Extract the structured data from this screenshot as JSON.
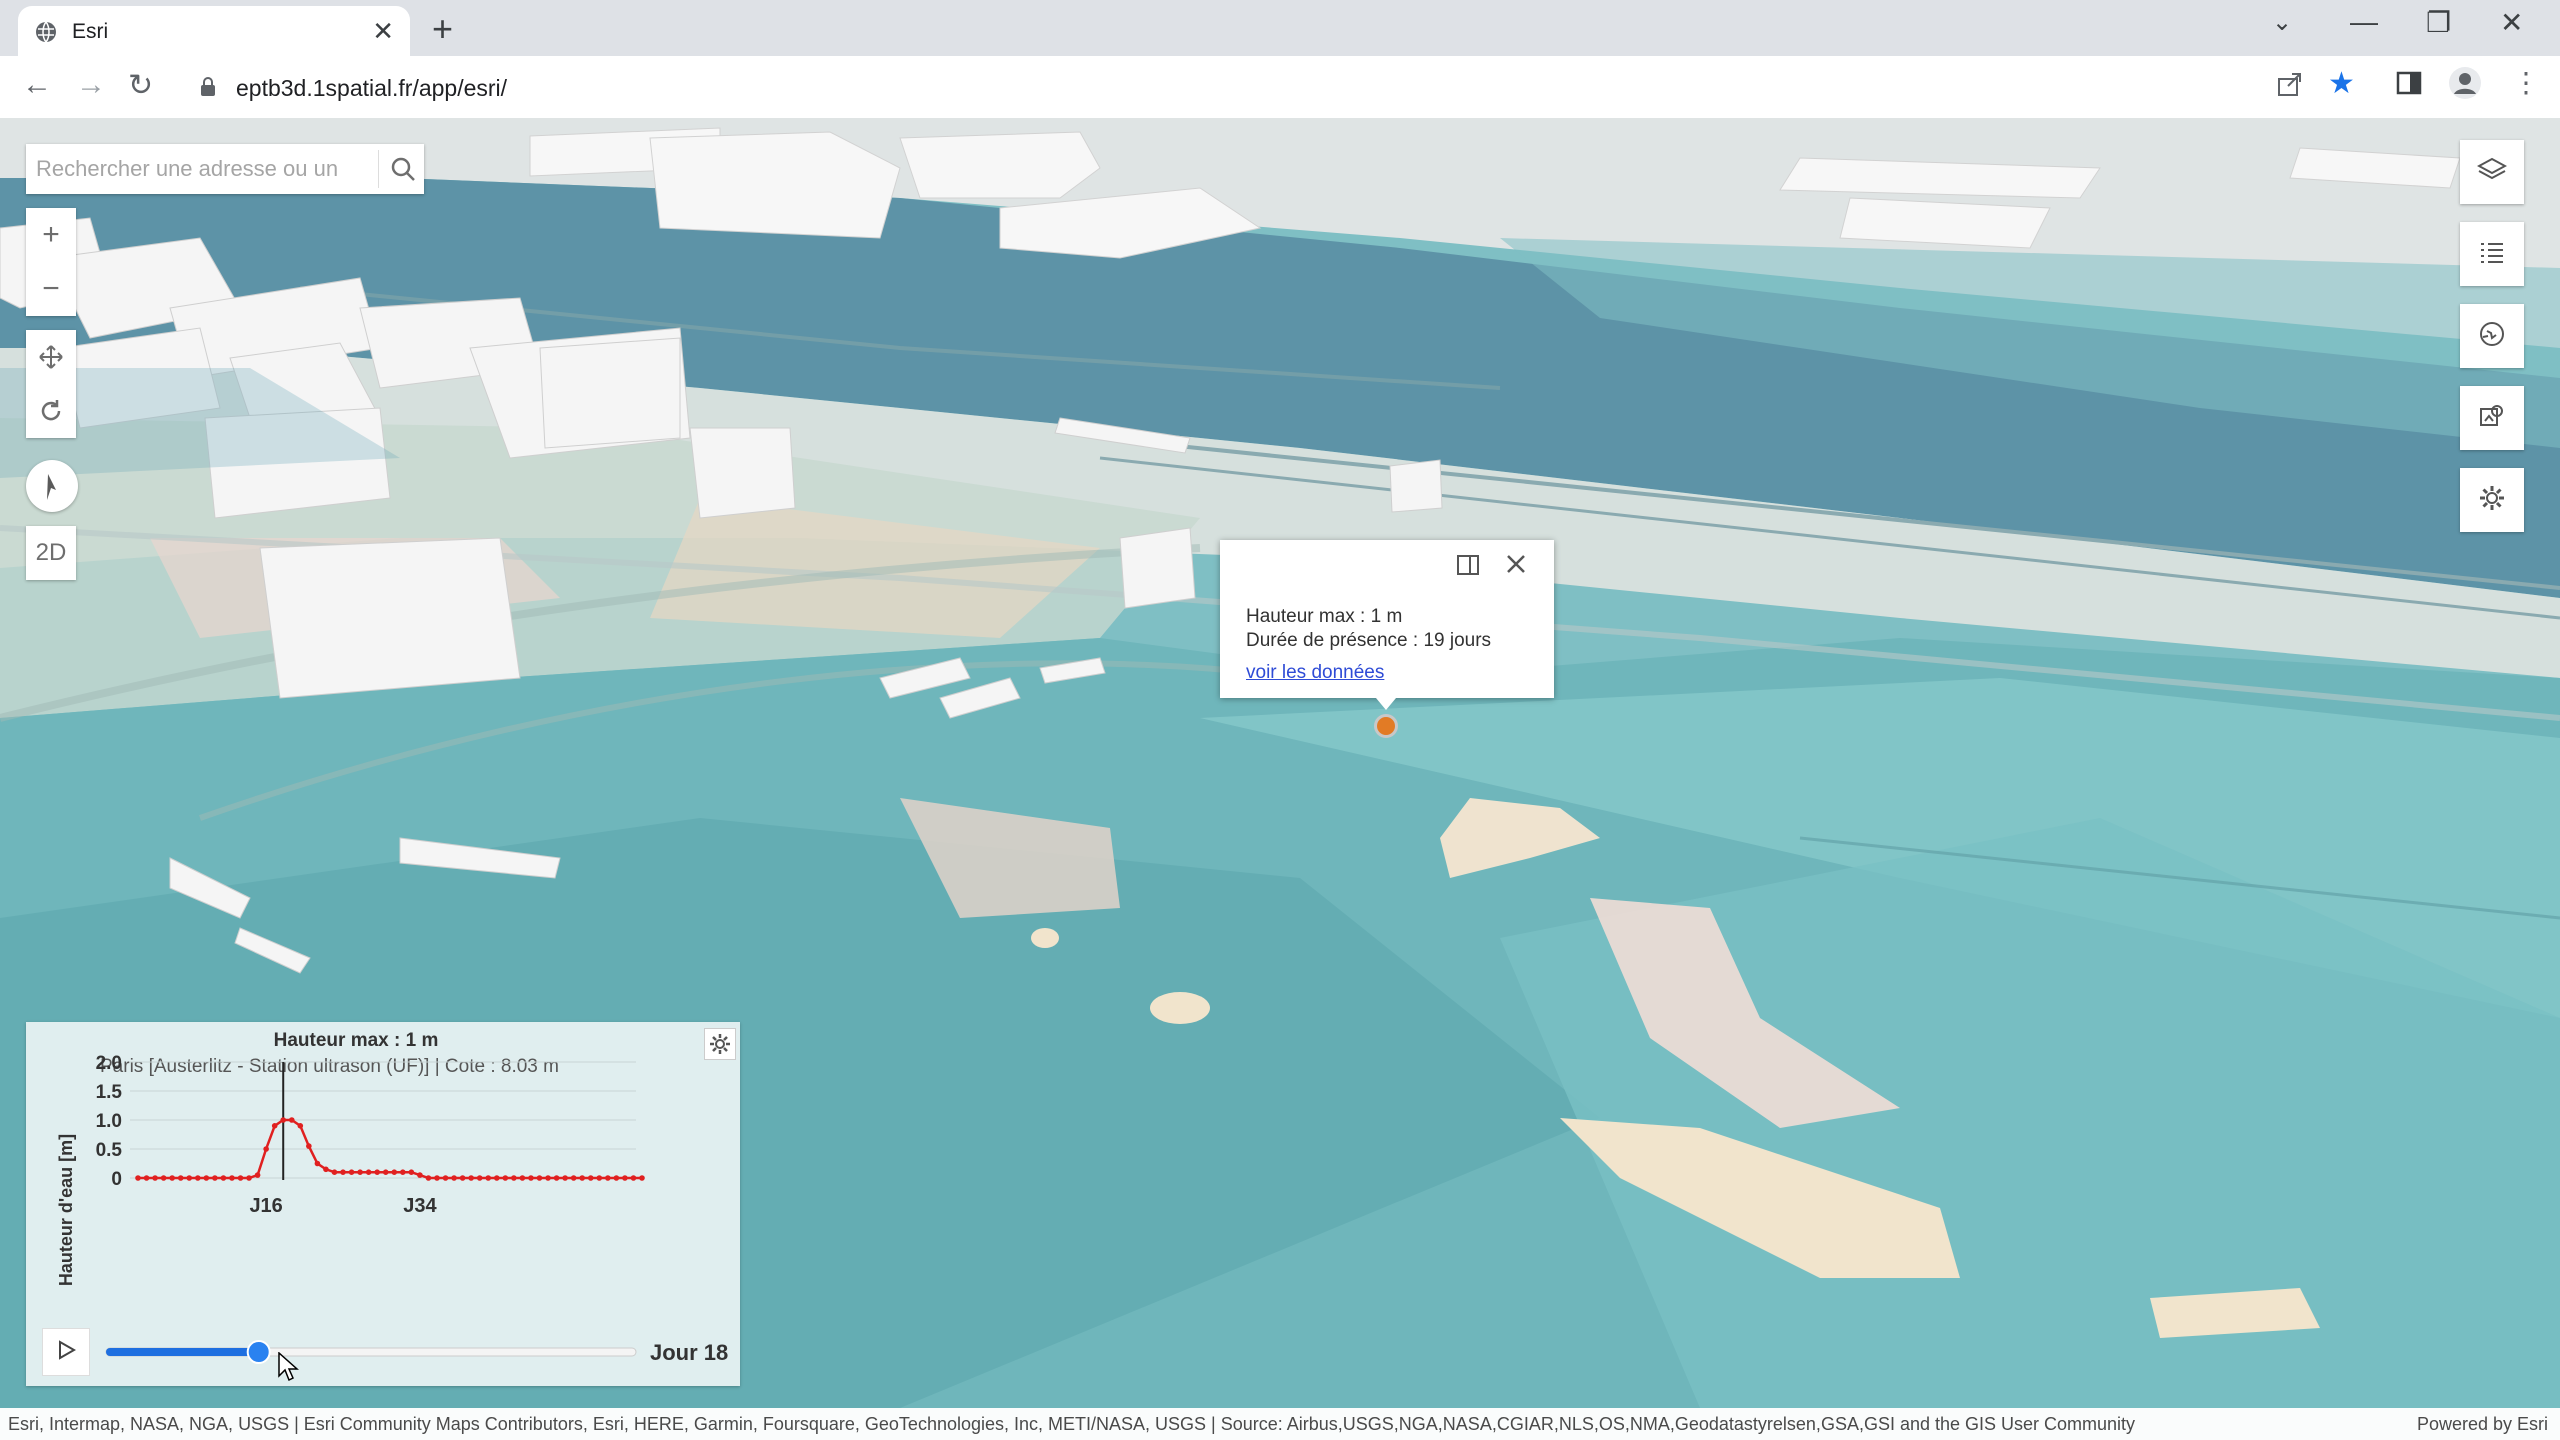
{
  "browser": {
    "tab_title": "Esri",
    "url": "eptb3d.1spatial.fr/app/esri/"
  },
  "search": {
    "placeholder": "Rechercher une adresse ou un"
  },
  "nav": {
    "view_toggle": "2D"
  },
  "popup": {
    "line1": "Hauteur max : 1 m",
    "line2": "Durée de présence : 19 jours",
    "link": "voir les données"
  },
  "chart_panel": {
    "title": "Hauteur max : 1 m",
    "subtitle": "Paris [Austerlitz - Station ultrason (UF)]   |   Cote : 8.03 m",
    "day_label": "Jour 18",
    "slider_value": 18
  },
  "chart_data": {
    "type": "line",
    "ylabel": "Hauteur d'eau [m]",
    "ylim": [
      0,
      2.0
    ],
    "yticks": [
      "2.0",
      "1.5",
      "1.0",
      "0.5",
      "0"
    ],
    "xticks": [
      "J16",
      "J34"
    ],
    "current_day": 18,
    "series": [
      {
        "color": "#e02020",
        "x": [
          1,
          2,
          3,
          4,
          5,
          6,
          7,
          8,
          9,
          10,
          11,
          12,
          13,
          14,
          15,
          16,
          17,
          18,
          19,
          20,
          21,
          22,
          23,
          24,
          25,
          26,
          27,
          28,
          29,
          30,
          31,
          32,
          33,
          34,
          35,
          36,
          37,
          38,
          39,
          40,
          41,
          42,
          43,
          44,
          45,
          46,
          47,
          48,
          49,
          50,
          51,
          52,
          53,
          54,
          55,
          56,
          57,
          58,
          59,
          60
        ],
        "values": [
          0,
          0,
          0,
          0,
          0,
          0,
          0,
          0,
          0,
          0,
          0,
          0,
          0,
          0,
          0.05,
          0.5,
          0.9,
          1.0,
          1.0,
          0.9,
          0.55,
          0.25,
          0.15,
          0.1,
          0.1,
          0.1,
          0.1,
          0.1,
          0.1,
          0.1,
          0.1,
          0.1,
          0.1,
          0.05,
          0,
          0,
          0,
          0,
          0,
          0,
          0,
          0,
          0,
          0,
          0,
          0,
          0,
          0,
          0,
          0,
          0,
          0,
          0,
          0,
          0,
          0,
          0,
          0,
          0,
          0
        ]
      }
    ]
  },
  "attribution": {
    "text": "Esri, Intermap, NASA, NGA, USGS | Esri Community Maps Contributors, Esri, HERE, Garmin, Foursquare, GeoTechnologies, Inc, METI/NASA, USGS | Source: Airbus,USGS,NGA,NASA,CGIAR,NLS,OS,NMA,Geodatastyrelsen,GSA,GSI and the GIS User Community",
    "powered": "Powered by Esri"
  },
  "colors": {
    "water": "#5d93a7",
    "flood": "#8ecdd0",
    "marker": "#e27b25",
    "series": "#e02020",
    "slider": "#1e6fe0",
    "star": "#1a73e8"
  },
  "icons": [
    "globe-icon",
    "close-icon",
    "plus-icon",
    "back-icon",
    "forward-icon",
    "reload-icon",
    "lock-icon",
    "share-icon",
    "star-icon",
    "sidepanel-icon",
    "profile-icon",
    "menu-icon",
    "search-icon",
    "zoom-in-icon",
    "zoom-out-icon",
    "pan-icon",
    "rotate-icon",
    "compass-icon",
    "layers-icon",
    "legend-icon",
    "basemap-icon",
    "daylight-icon",
    "settings-icon",
    "dock-icon",
    "gear-icon",
    "play-icon"
  ]
}
